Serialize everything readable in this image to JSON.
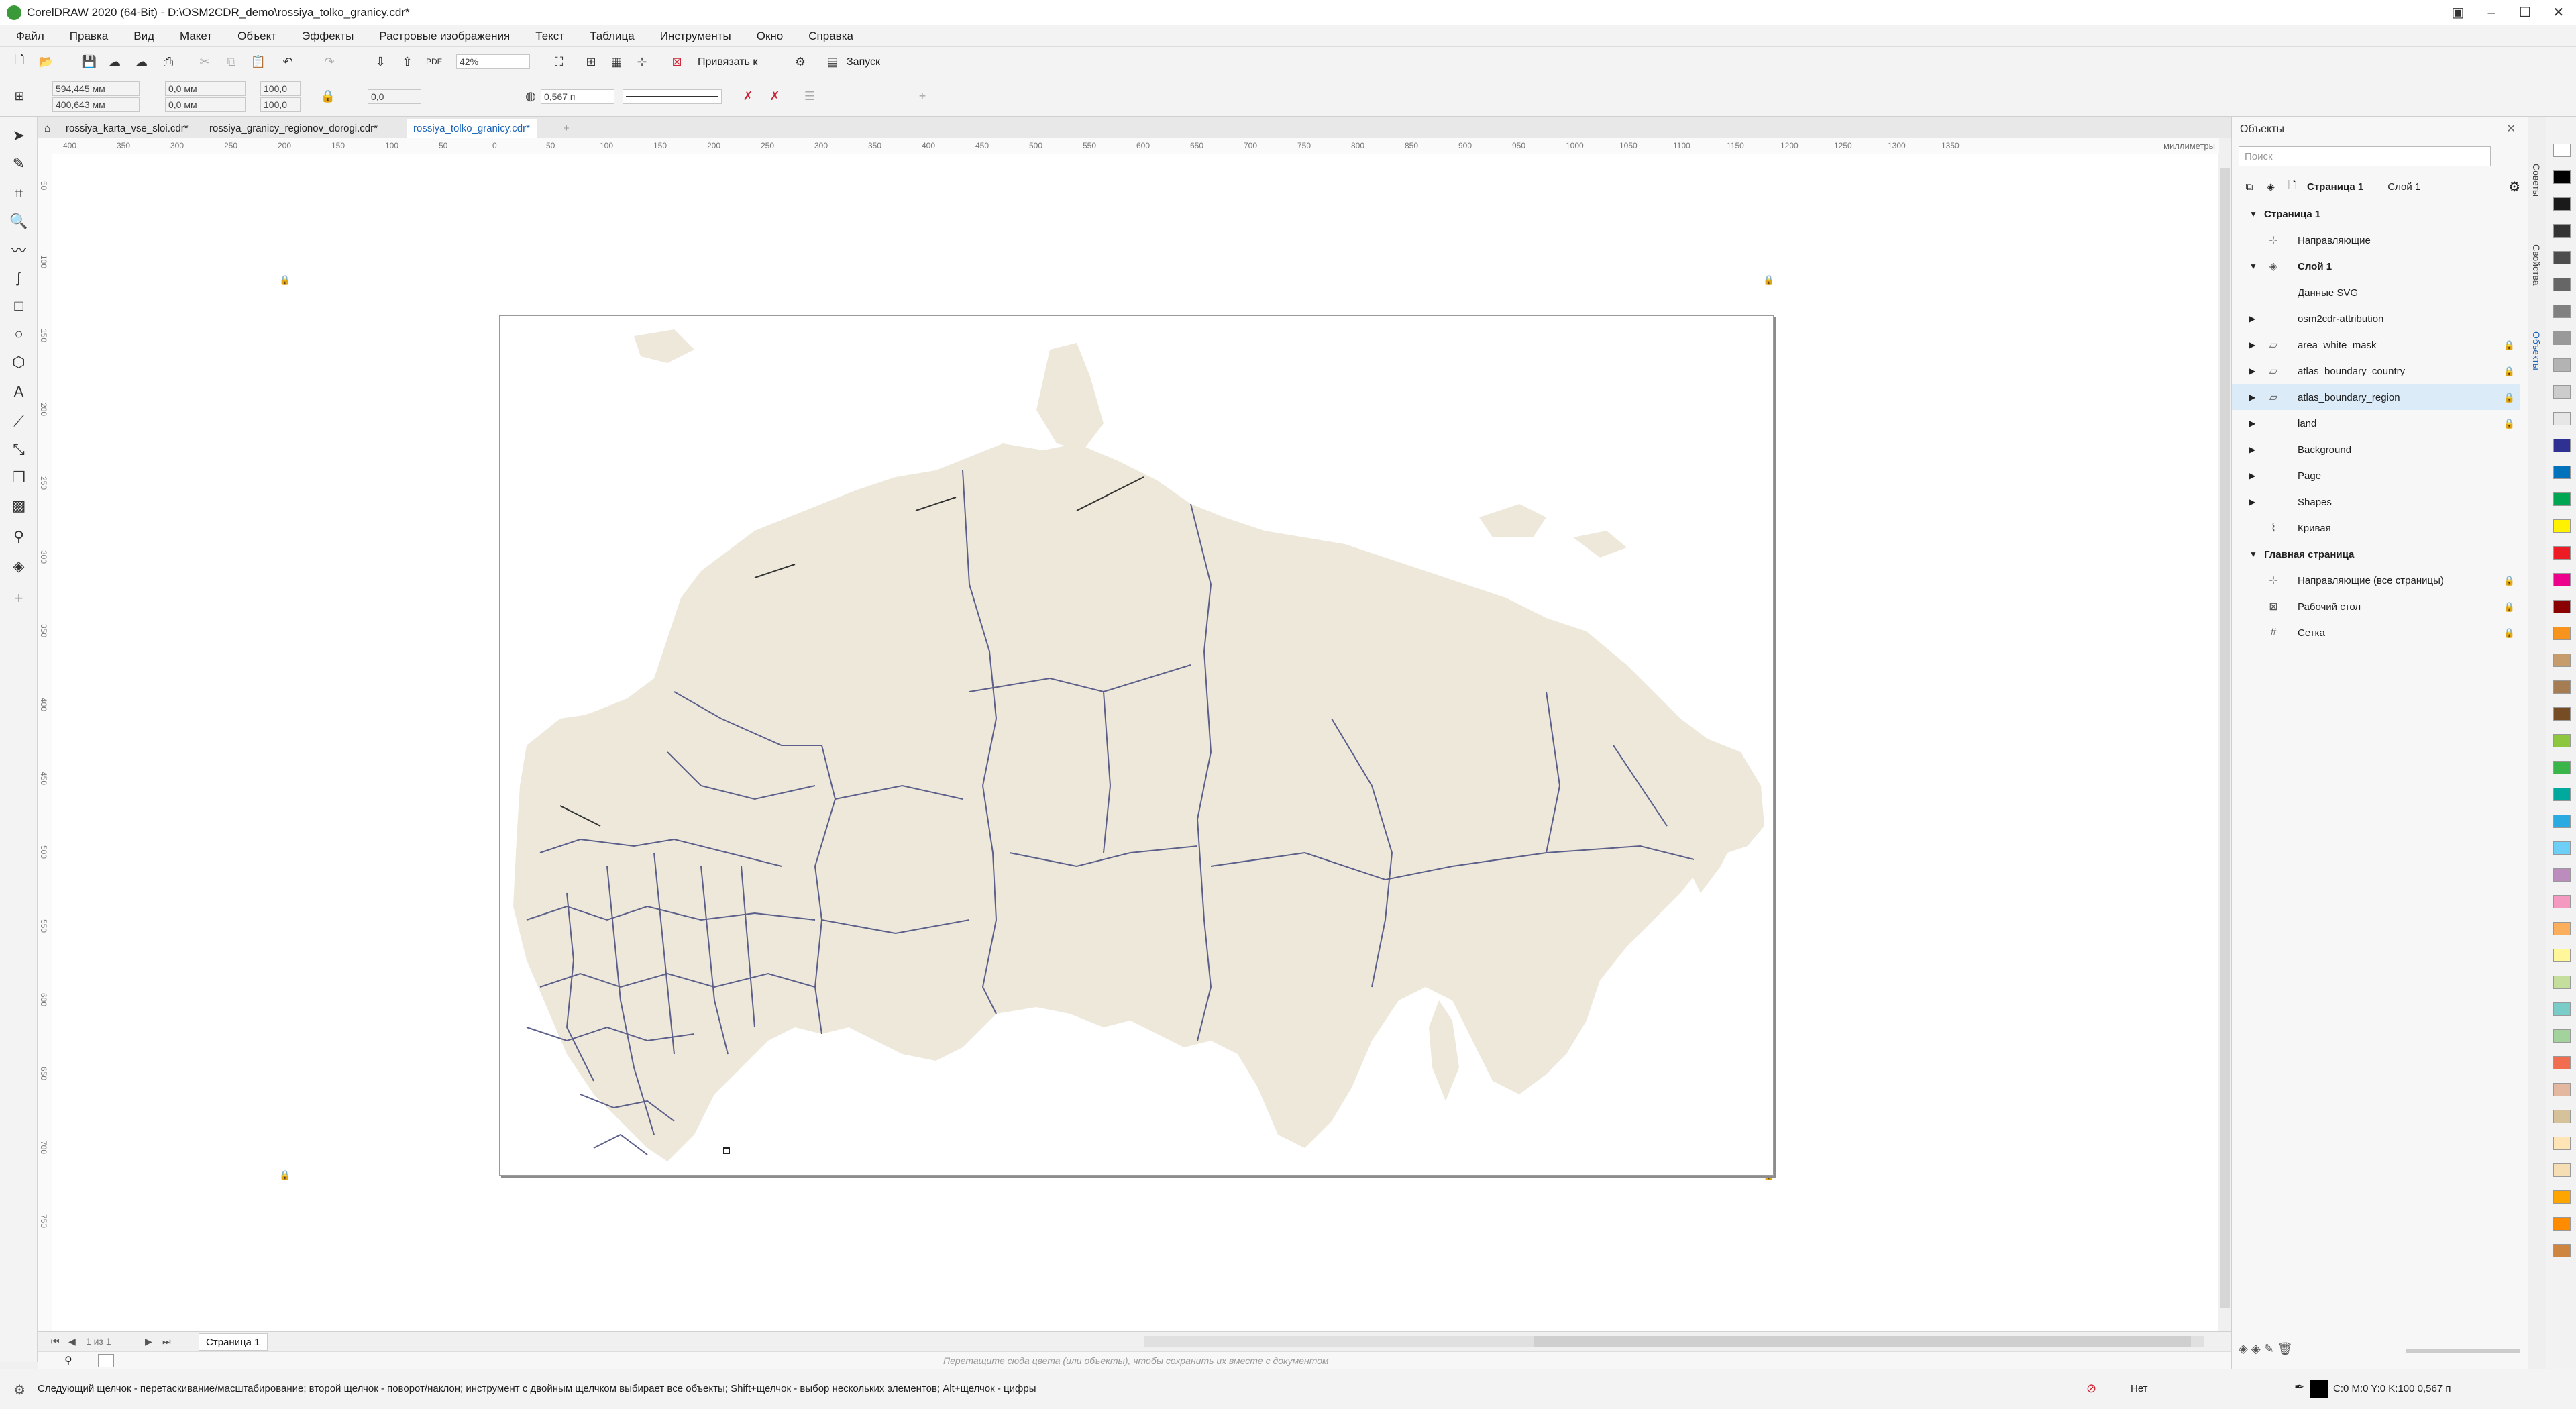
{
  "title": "CorelDRAW 2020 (64-Bit) - D:\\OSM2CDR_demo\\rossiya_tolko_granicy.cdr*",
  "menu": [
    "Файл",
    "Правка",
    "Вид",
    "Макет",
    "Объект",
    "Эффекты",
    "Растровые изображения",
    "Текст",
    "Таблица",
    "Инструменты",
    "Окно",
    "Справка"
  ],
  "toolbar": {
    "zoom": "42%",
    "snap": "Привязать к",
    "launch": "Запуск"
  },
  "props": {
    "x": "594,445 мм",
    "y": "400,643 мм",
    "w": "0,0 мм",
    "h": "0,0 мм",
    "sx": "100,0",
    "sy": "100,0",
    "rotation": "0,0",
    "outline": "0,567 п"
  },
  "tabs": [
    "rossiya_karta_vse_sloi.cdr*",
    "rossiya_granicy_regionov_dorogi.cdr*",
    "rossiya_tolko_granicy.cdr*"
  ],
  "ruler_h": [
    "400",
    "350",
    "300",
    "250",
    "200",
    "150",
    "100",
    "50",
    "0",
    "50",
    "100",
    "150",
    "200",
    "250",
    "300",
    "350",
    "400",
    "450",
    "500",
    "550",
    "600",
    "650",
    "700",
    "750",
    "800",
    "850",
    "900",
    "950",
    "1000",
    "1050",
    "1100",
    "1150",
    "1200",
    "1250",
    "1300",
    "1350"
  ],
  "ruler_unit": "миллиметры",
  "ruler_v": [
    "50",
    "100",
    "150",
    "200",
    "250",
    "300",
    "350",
    "400",
    "450",
    "500",
    "550",
    "600",
    "650",
    "700",
    "750"
  ],
  "page_nav": {
    "counter": "1 из 1",
    "page_tab": "Страница 1"
  },
  "color_hint": "Перетащите сюда цвета (или объекты), чтобы сохранить их вместе с документом",
  "status": {
    "text": "Следующий щелчок - перетаскивание/масштабирование; второй щелчок - поворот/наклон; инструмент с двойным щелчком выбирает все объекты; Shift+щелчок - выбор нескольких элементов; Alt+щелчок - цифры",
    "fill": "Нет",
    "outline": "C:0 M:0 Y:0 K:100  0,567 п"
  },
  "docker": {
    "title": "Объекты",
    "search_placeholder": "Поиск",
    "page_label": "Страница 1",
    "layer_label": "Слой 1",
    "rows": [
      {
        "label": "Страница 1",
        "bold": true
      },
      {
        "label": "Направляющие"
      },
      {
        "label": "Слой 1",
        "bold": true
      },
      {
        "label": "Данные SVG"
      },
      {
        "label": "osm2cdr-attribution"
      },
      {
        "label": "area_white_mask"
      },
      {
        "label": "atlas_boundary_country"
      },
      {
        "label": "atlas_boundary_region",
        "selected": true
      },
      {
        "label": "land"
      },
      {
        "label": "Background"
      },
      {
        "label": "Page"
      },
      {
        "label": "Shapes"
      },
      {
        "label": "Кривая"
      },
      {
        "label": "Главная страница",
        "bold": true
      },
      {
        "label": "Направляющие (все страницы)"
      },
      {
        "label": "Рабочий стол"
      },
      {
        "label": "Сетка"
      }
    ]
  },
  "side_tabs": [
    "Советы",
    "Свойства",
    "Объекты"
  ],
  "palette": [
    "#ffffff",
    "#000000",
    "#1a1a1a",
    "#333333",
    "#4d4d4d",
    "#666666",
    "#808080",
    "#999999",
    "#b3b3b3",
    "#cccccc",
    "#e6e6e6",
    "#2e3192",
    "#0072bc",
    "#00a651",
    "#fff200",
    "#ed1c24",
    "#ec008c",
    "#8b0000",
    "#f7941d",
    "#c69c6d",
    "#a67c52",
    "#754c24",
    "#8dc63f",
    "#39b54a",
    "#00a99d",
    "#29abe2",
    "#6dcff6",
    "#bd8cbf",
    "#f49ac1",
    "#fbaf5d",
    "#fff799",
    "#c4df9b",
    "#7accc8",
    "#a3d39c",
    "#f26c4f",
    "#e4b7a0",
    "#d6c29a",
    "#ffe4b5",
    "#f5deb3",
    "#ffa500",
    "#ff8c00",
    "#cd853f"
  ]
}
